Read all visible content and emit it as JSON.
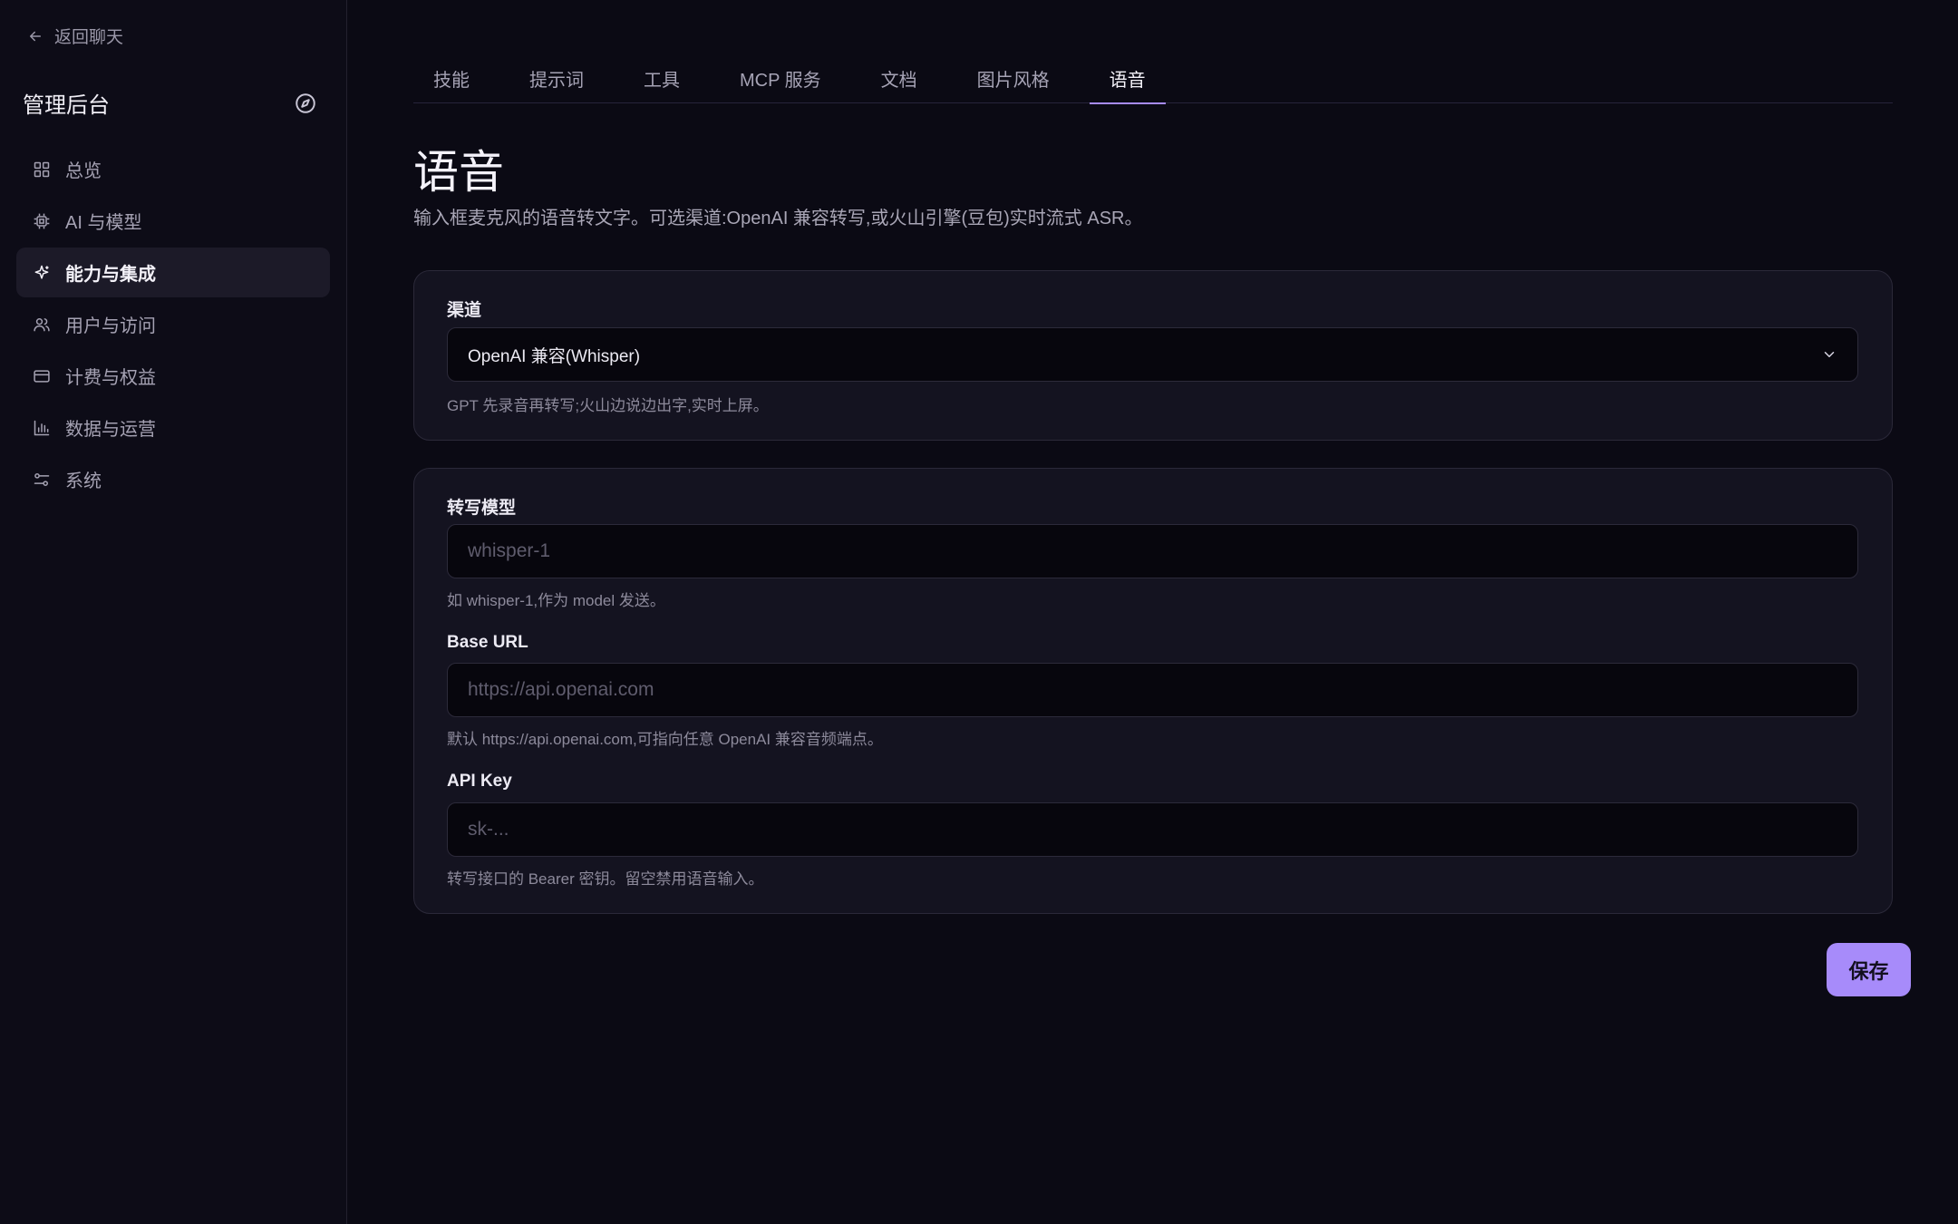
{
  "sidebar": {
    "back_label": "返回聊天",
    "brand_title": "管理后台",
    "items": [
      {
        "label": "总览",
        "icon": "dashboard-icon"
      },
      {
        "label": "AI 与模型",
        "icon": "chip-icon"
      },
      {
        "label": "能力与集成",
        "icon": "sparkle-icon",
        "active": true
      },
      {
        "label": "用户与访问",
        "icon": "users-icon"
      },
      {
        "label": "计费与权益",
        "icon": "credit-card-icon"
      },
      {
        "label": "数据与运营",
        "icon": "bar-chart-icon"
      },
      {
        "label": "系统",
        "icon": "sliders-icon"
      }
    ]
  },
  "tabs": [
    {
      "label": "技能"
    },
    {
      "label": "提示词"
    },
    {
      "label": "工具"
    },
    {
      "label": "MCP 服务"
    },
    {
      "label": "文档"
    },
    {
      "label": "图片风格"
    },
    {
      "label": "语音",
      "active": true
    }
  ],
  "page": {
    "title": "语音",
    "description": "输入框麦克风的语音转文字。可选渠道:OpenAI 兼容转写,或火山引擎(豆包)实时流式 ASR。"
  },
  "channel": {
    "label": "渠道",
    "value": "OpenAI 兼容(Whisper)",
    "help": "GPT 先录音再转写;火山边说边出字,实时上屏。"
  },
  "model": {
    "label": "转写模型",
    "placeholder": "whisper-1",
    "help": "如 whisper-1,作为 model 发送。"
  },
  "base_url": {
    "label": "Base URL",
    "placeholder": "https://api.openai.com",
    "help": "默认 https://api.openai.com,可指向任意 OpenAI 兼容音频端点。"
  },
  "api_key": {
    "label": "API Key",
    "placeholder": "sk-...",
    "help": "转写接口的 Bearer 密钥。留空禁用语音输入。"
  },
  "save_label": "保存",
  "colors": {
    "accent": "#a78bfa",
    "background": "#0b0a14",
    "card": "#141320"
  }
}
